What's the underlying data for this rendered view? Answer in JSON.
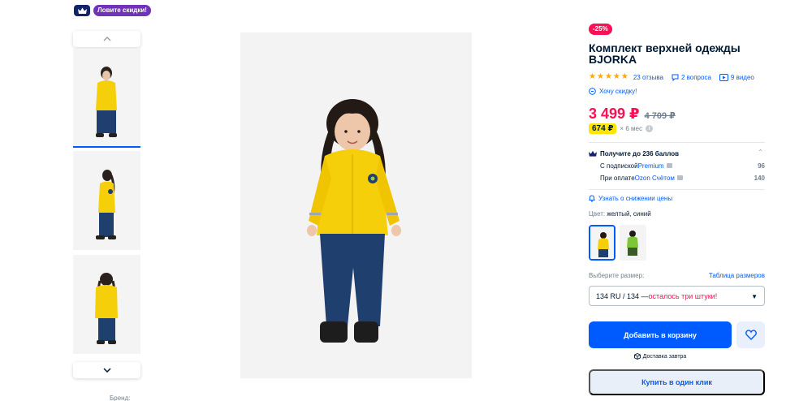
{
  "top_badges": {
    "crown_icon": "crown-icon",
    "promo": "Ловите скидки!"
  },
  "gallery": {
    "up_arrow": "⌃",
    "down_arrow": "⌄"
  },
  "product": {
    "discount": "-25%",
    "title": "Комплект верхней одежды BJORKA",
    "rating_stars": 5,
    "reviews": "23 отзыва",
    "questions": "2 вопроса",
    "videos": "9 видео",
    "want_discount": "Хочу скидку!"
  },
  "price": {
    "current": "3 499 ₽",
    "old": "4 709 ₽",
    "installment": "674 ₽",
    "installment_months": "× 6 мес"
  },
  "points": {
    "title": "Получите до 236 баллов",
    "rows": [
      {
        "prefix": "С подпиской ",
        "link": "Premium",
        "value": "96"
      },
      {
        "prefix": "При оплате ",
        "link": "Ozon Счётом",
        "value": "140"
      }
    ]
  },
  "notify": "Узнать о снижении цены",
  "color": {
    "label": "Цвет: ",
    "value": "желтый, синий"
  },
  "size": {
    "label": "Выберите размер:",
    "table_link": "Таблица размеров",
    "selected": "134 RU / 134 — ",
    "warning": "осталось три штуки!"
  },
  "actions": {
    "add_to_cart": "Добавить в корзину",
    "delivery": "Доставка завтра",
    "one_click": "Купить в один клик"
  },
  "brand_label": "Бренд:",
  "colors": {
    "accent": "#005bff",
    "sale": "#f91155",
    "promo": "#6f33b7",
    "installment": "#ffe500",
    "jacket": "#f5cf0a",
    "pants": "#1f3f6e"
  }
}
